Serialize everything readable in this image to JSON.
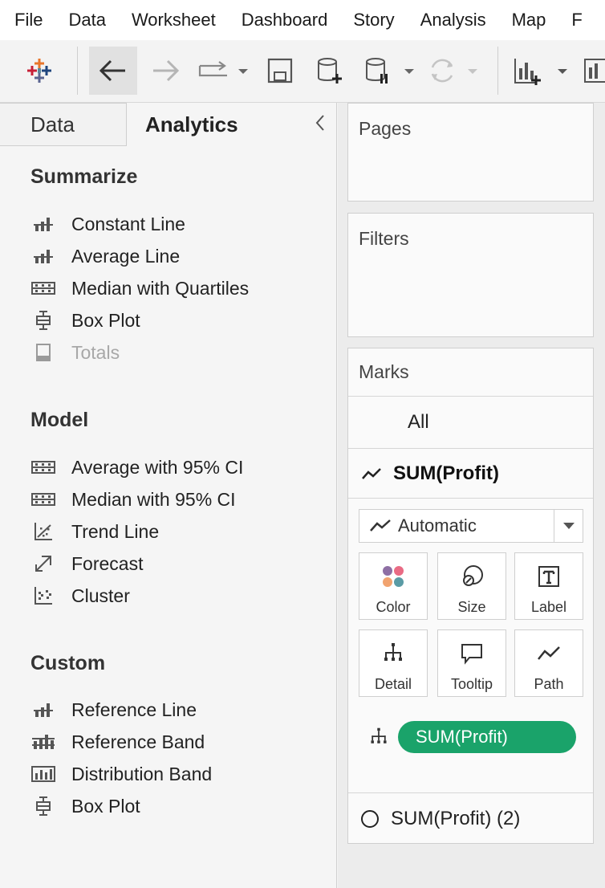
{
  "menu": [
    "File",
    "Data",
    "Worksheet",
    "Dashboard",
    "Story",
    "Analysis",
    "Map",
    "F"
  ],
  "toolbar": {
    "icons": [
      "tableau-logo-icon",
      "back-icon",
      "forward-icon",
      "redo-icon",
      "save-icon",
      "new-datasource-icon",
      "pause-updates-icon",
      "refresh-icon",
      "new-worksheet-icon",
      "new-dashboard-icon"
    ]
  },
  "tabs": {
    "data": "Data",
    "analytics": "Analytics"
  },
  "summarize": {
    "title": "Summarize",
    "items": [
      "Constant Line",
      "Average Line",
      "Median with Quartiles",
      "Box Plot",
      "Totals"
    ]
  },
  "model": {
    "title": "Model",
    "items": [
      "Average with 95% CI",
      "Median with 95% CI",
      "Trend Line",
      "Forecast",
      "Cluster"
    ]
  },
  "custom": {
    "title": "Custom",
    "items": [
      "Reference Line",
      "Reference Band",
      "Distribution Band",
      "Box Plot"
    ]
  },
  "pages": {
    "title": "Pages"
  },
  "filters": {
    "title": "Filters"
  },
  "marks": {
    "title": "Marks",
    "all": "All",
    "measure": "SUM(Profit)",
    "mark_type": "Automatic",
    "buttons": [
      "Color",
      "Size",
      "Label",
      "Detail",
      "Tooltip",
      "Path"
    ],
    "pill": "SUM(Profit)",
    "second_measure": "SUM(Profit) (2)"
  },
  "colors": {
    "pill": "#1aa36a",
    "accent": "#1aa36a"
  }
}
